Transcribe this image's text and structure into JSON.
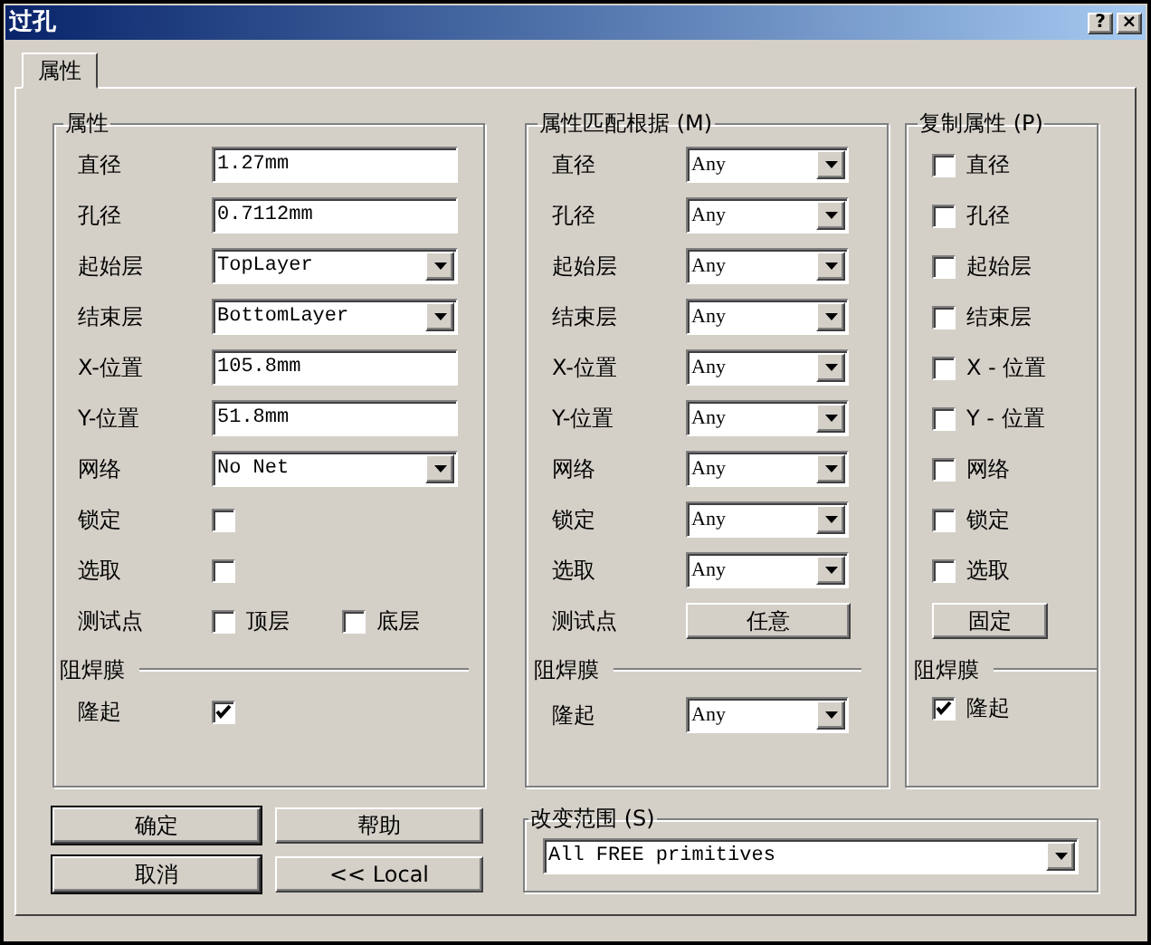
{
  "window": {
    "title": "过孔",
    "buttons": [
      "?",
      "×"
    ]
  },
  "tabs": [
    {
      "label": "属性",
      "selected": true
    }
  ],
  "properties": {
    "title": "属性",
    "rows": [
      {
        "label": "直径",
        "kind": "text",
        "value": "1.27mm"
      },
      {
        "label": "孔径",
        "kind": "text",
        "value": "0.7112mm"
      },
      {
        "label": "起始层",
        "kind": "dropdown",
        "value": "TopLayer"
      },
      {
        "label": "结束层",
        "kind": "dropdown",
        "value": "BottomLayer"
      },
      {
        "label": "X-位置",
        "kind": "text",
        "value": "105.8mm"
      },
      {
        "label": "Y-位置",
        "kind": "text",
        "value": "51.8mm"
      },
      {
        "label": "网络",
        "kind": "dropdown",
        "value": "No Net"
      },
      {
        "label": "锁定",
        "kind": "checkbox",
        "checked": false
      },
      {
        "label": "选取",
        "kind": "checkbox",
        "checked": false
      },
      {
        "label": "测试点",
        "kind": "options",
        "options": [
          {
            "label": "顶层",
            "checked": false
          },
          {
            "label": "底层",
            "checked": false
          }
        ]
      }
    ],
    "solder_mask": {
      "title": "阻焊膜",
      "rows": [
        {
          "label": "隆起",
          "kind": "checkbox",
          "checked": true
        }
      ]
    }
  },
  "match_by": {
    "title": "属性匹配根据 (M)",
    "rows": [
      {
        "label": "直径",
        "kind": "dropdown",
        "value": "Any"
      },
      {
        "label": "孔径",
        "kind": "dropdown",
        "value": "Any"
      },
      {
        "label": "起始层",
        "kind": "dropdown",
        "value": "Any"
      },
      {
        "label": "结束层",
        "kind": "dropdown",
        "value": "Any"
      },
      {
        "label": "X-位置",
        "kind": "dropdown",
        "value": "Any"
      },
      {
        "label": "Y-位置",
        "kind": "dropdown",
        "value": "Any"
      },
      {
        "label": "网络",
        "kind": "dropdown",
        "value": "Any"
      },
      {
        "label": "锁定",
        "kind": "dropdown",
        "value": "Any"
      },
      {
        "label": "选取",
        "kind": "dropdown",
        "value": "Any"
      },
      {
        "label": "测试点",
        "kind": "button",
        "value": "任意"
      }
    ],
    "solder_mask": {
      "title": "阻焊膜",
      "rows": [
        {
          "label": "隆起",
          "kind": "dropdown",
          "value": "Any"
        }
      ]
    }
  },
  "copy_attributes": {
    "title": "复制属性 (P)",
    "items": [
      {
        "label": "直径",
        "kind": "checkbox",
        "checked": false
      },
      {
        "label": "孔径",
        "kind": "checkbox",
        "checked": false
      },
      {
        "label": "起始层",
        "kind": "checkbox",
        "checked": false
      },
      {
        "label": "结束层",
        "kind": "checkbox",
        "checked": false
      },
      {
        "label": "X - 位置",
        "kind": "checkbox",
        "checked": false
      },
      {
        "label": "Y - 位置",
        "kind": "checkbox",
        "checked": false
      },
      {
        "label": "网络",
        "kind": "checkbox",
        "checked": false
      },
      {
        "label": "锁定",
        "kind": "checkbox",
        "checked": false
      },
      {
        "label": "选取",
        "kind": "checkbox",
        "checked": false
      },
      {
        "label": "固定",
        "kind": "button"
      }
    ],
    "solder_mask": {
      "title": "阻焊膜",
      "items": [
        {
          "label": "隆起",
          "kind": "checkbox",
          "checked": true
        }
      ]
    }
  },
  "buttons": [
    {
      "label": "确定",
      "default": true
    },
    {
      "label": "帮助",
      "default": false
    },
    {
      "label": "取消",
      "default": true
    },
    {
      "label": "<< Local",
      "default": false
    }
  ],
  "scope": {
    "title": "改变范围 (S)",
    "value": "All FREE primitives"
  }
}
